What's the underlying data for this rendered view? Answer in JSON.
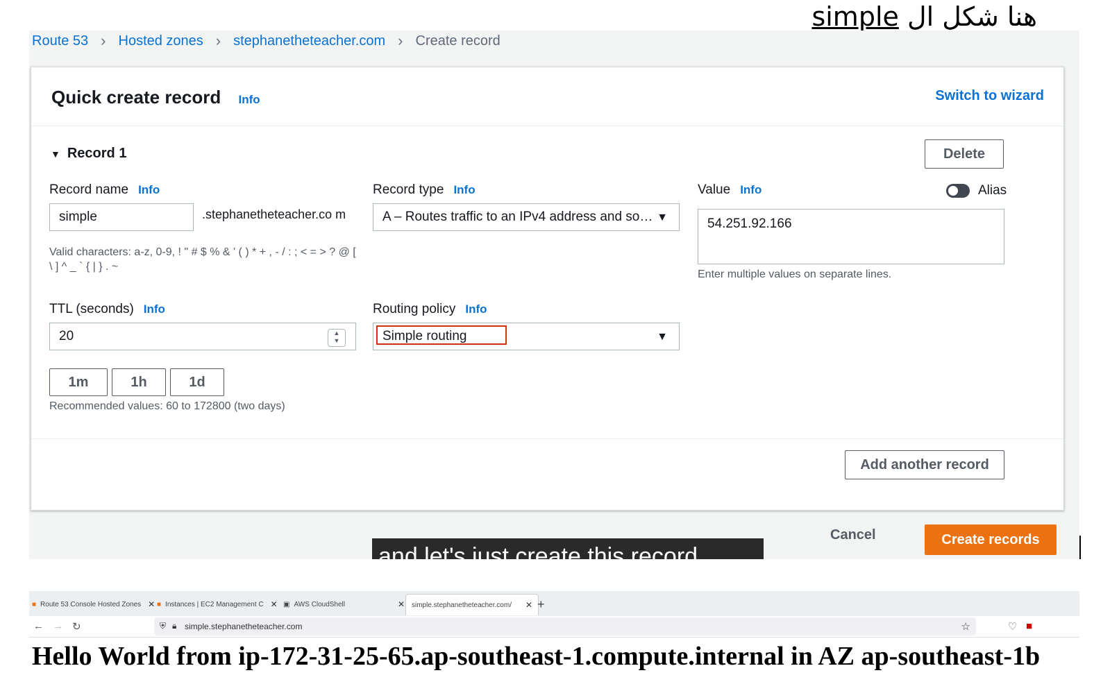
{
  "annotation": {
    "arabic": "هنا شكل ال",
    "word": "simple"
  },
  "breadcrumb": [
    "Route 53",
    "Hosted zones",
    "stephanetheteacher.com",
    "Create record"
  ],
  "header": {
    "title": "Quick create record",
    "info": "Info",
    "switch_wizard": "Switch to wizard"
  },
  "record": {
    "toggle_label": "Record 1",
    "delete_label": "Delete",
    "name": {
      "label": "Record name",
      "info": "Info",
      "value": "simple",
      "suffix": ".stephanetheteacher.co m",
      "hint": "Valid characters: a-z, 0-9, ! \" # $ % & ' ( ) * + , - / : ; < = > ? @ [ \\ ] ^ _ ` { | } . ~"
    },
    "type": {
      "label": "Record type",
      "info": "Info",
      "value": "A – Routes traffic to an IPv4 address and so…"
    },
    "value": {
      "label": "Value",
      "info": "Info",
      "alias_label": "Alias",
      "value": "54.251.92.166",
      "hint": "Enter multiple values on separate lines."
    },
    "ttl": {
      "label": "TTL (seconds)",
      "info": "Info",
      "value": "20",
      "presets": [
        "1m",
        "1h",
        "1d"
      ],
      "hint": "Recommended values: 60 to 172800 (two days)"
    },
    "routing": {
      "label": "Routing policy",
      "info": "Info",
      "value": "Simple routing"
    }
  },
  "footer": {
    "add_another": "Add another record",
    "cancel": "Cancel",
    "create": "Create records"
  },
  "caption": "and let's just create this record",
  "browser": {
    "tabs": [
      "Route 53 Console Hosted Zones",
      "Instances | EC2 Management C",
      "AWS CloudShell",
      "simple.stephanetheteacher.com/"
    ],
    "url": "simple.stephanetheteacher.com"
  },
  "page_text": "Hello World from ip-172-31-25-65.ap-southeast-1.compute.internal in AZ ap-southeast-1b",
  "colors": {
    "link": "#0972d3",
    "primary": "#ec7211",
    "highlight": "#d13212"
  }
}
